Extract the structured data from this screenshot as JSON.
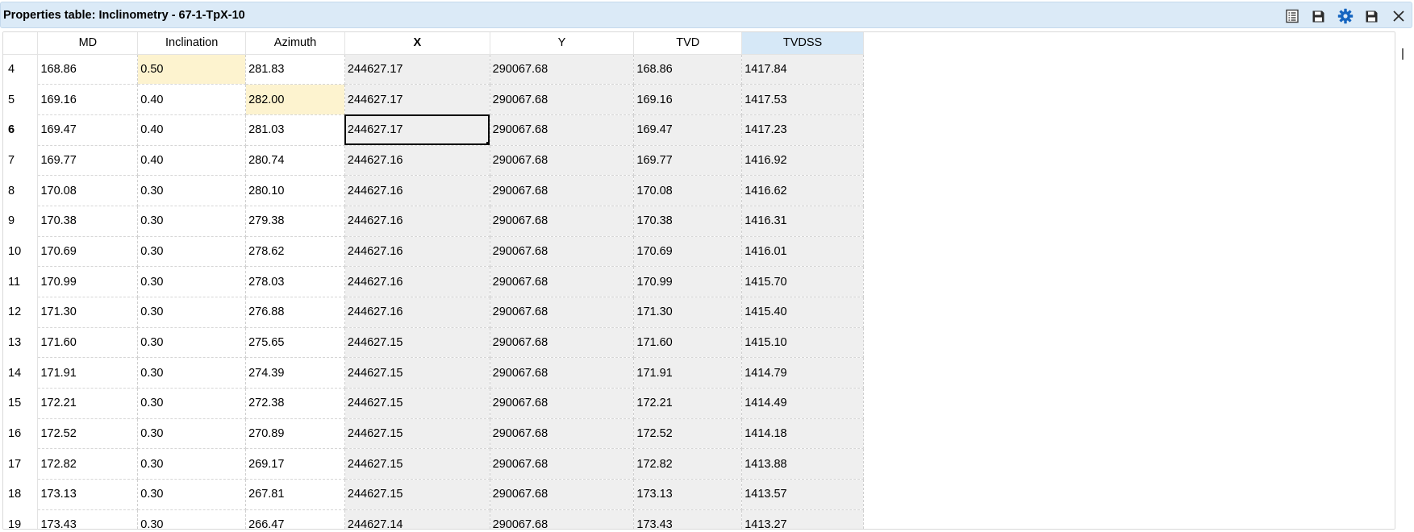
{
  "window": {
    "title": "Properties table: Inclinometry - 67-1-TpX-10"
  },
  "toolbar": {
    "buttons": [
      {
        "name": "table-view-icon",
        "color": "#3a3a3a"
      },
      {
        "name": "save-icon",
        "color": "#2a2a2a"
      },
      {
        "name": "gear-icon",
        "color": "#1565c0"
      },
      {
        "name": "save-as-icon",
        "color": "#2a2a2a"
      },
      {
        "name": "close-icon",
        "color": "#2a2a2a"
      }
    ]
  },
  "colors": {
    "title_bar": "#dbeaf7",
    "readonly_cell": "#efefef",
    "edited_cell": "#fdf3cf",
    "active_header": "#d6e8f7"
  },
  "table": {
    "columns": [
      "MD",
      "Inclination",
      "Azimuth",
      "X",
      "Y",
      "TVD",
      "TVDSS"
    ],
    "rows": [
      {
        "num": "4",
        "cells": [
          "168.86",
          "0.50",
          "281.83",
          "244627.17",
          "290067.68",
          "168.86",
          "1417.84"
        ]
      },
      {
        "num": "5",
        "cells": [
          "169.16",
          "0.40",
          "282.00",
          "244627.17",
          "290067.68",
          "169.16",
          "1417.53"
        ]
      },
      {
        "num": "6",
        "cells": [
          "169.47",
          "0.40",
          "281.03",
          "244627.17",
          "290067.68",
          "169.47",
          "1417.23"
        ]
      },
      {
        "num": "7",
        "cells": [
          "169.77",
          "0.40",
          "280.74",
          "244627.16",
          "290067.68",
          "169.77",
          "1416.92"
        ]
      },
      {
        "num": "8",
        "cells": [
          "170.08",
          "0.30",
          "280.10",
          "244627.16",
          "290067.68",
          "170.08",
          "1416.62"
        ]
      },
      {
        "num": "9",
        "cells": [
          "170.38",
          "0.30",
          "279.38",
          "244627.16",
          "290067.68",
          "170.38",
          "1416.31"
        ]
      },
      {
        "num": "10",
        "cells": [
          "170.69",
          "0.30",
          "278.62",
          "244627.16",
          "290067.68",
          "170.69",
          "1416.01"
        ]
      },
      {
        "num": "11",
        "cells": [
          "170.99",
          "0.30",
          "278.03",
          "244627.16",
          "290067.68",
          "170.99",
          "1415.70"
        ]
      },
      {
        "num": "12",
        "cells": [
          "171.30",
          "0.30",
          "276.88",
          "244627.16",
          "290067.68",
          "171.30",
          "1415.40"
        ]
      },
      {
        "num": "13",
        "cells": [
          "171.60",
          "0.30",
          "275.65",
          "244627.15",
          "290067.68",
          "171.60",
          "1415.10"
        ]
      },
      {
        "num": "14",
        "cells": [
          "171.91",
          "0.30",
          "274.39",
          "244627.15",
          "290067.68",
          "171.91",
          "1414.79"
        ]
      },
      {
        "num": "15",
        "cells": [
          "172.21",
          "0.30",
          "272.38",
          "244627.15",
          "290067.68",
          "172.21",
          "1414.49"
        ]
      },
      {
        "num": "16",
        "cells": [
          "172.52",
          "0.30",
          "270.89",
          "244627.15",
          "290067.68",
          "172.52",
          "1414.18"
        ]
      },
      {
        "num": "17",
        "cells": [
          "172.82",
          "0.30",
          "269.17",
          "244627.15",
          "290067.68",
          "172.82",
          "1413.88"
        ]
      },
      {
        "num": "18",
        "cells": [
          "173.13",
          "0.30",
          "267.81",
          "244627.15",
          "290067.68",
          "173.13",
          "1413.57"
        ]
      },
      {
        "num": "19",
        "cells": [
          "173.43",
          "0.30",
          "266.47",
          "244627.14",
          "290067.68",
          "173.43",
          "1413.27"
        ]
      }
    ]
  }
}
